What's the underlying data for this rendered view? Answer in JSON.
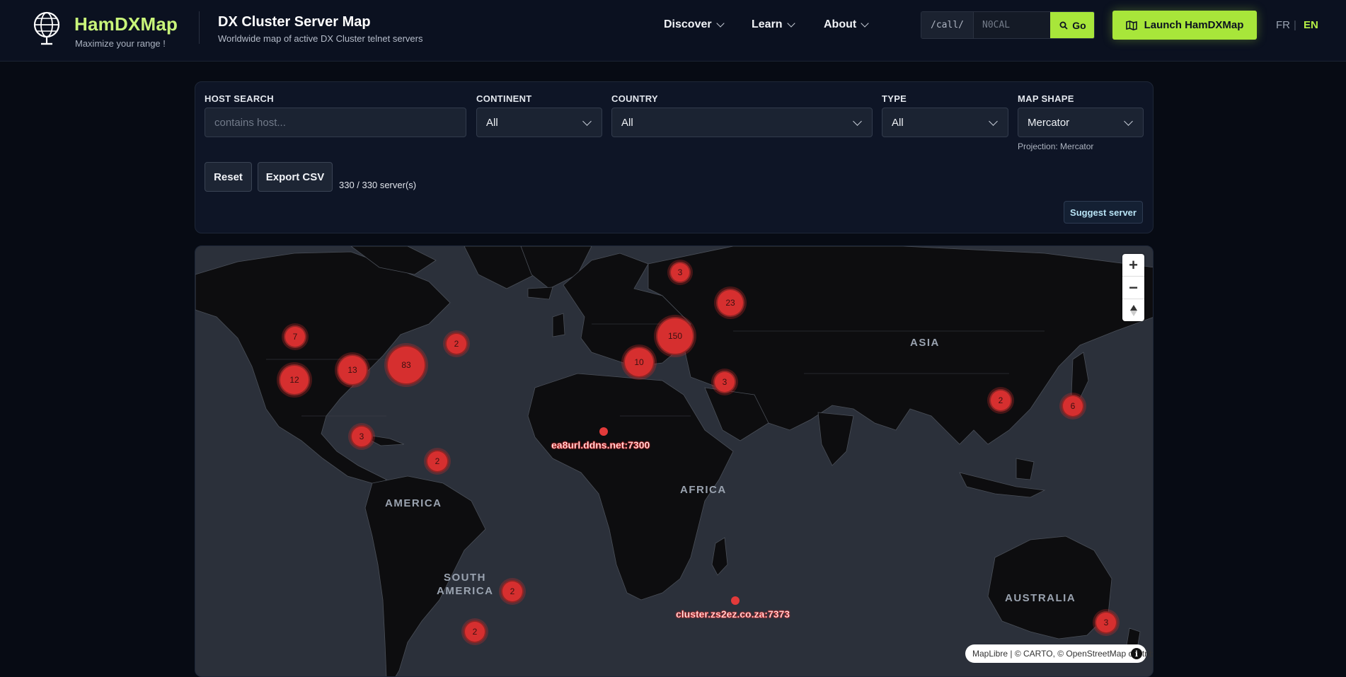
{
  "header": {
    "brand": "HamDXMap",
    "tagline": "Maximize your range !",
    "title": "DX Cluster Server Map",
    "subtitle": "Worldwide map of active DX Cluster telnet servers",
    "nav": [
      "Discover",
      "Learn",
      "About"
    ],
    "call_prefix": "/call/",
    "call_placeholder": "N0CAL",
    "go_label": "Go",
    "launch_label": "Launch HamDXMap",
    "lang_fr": "FR",
    "lang_sep": "|",
    "lang_en": "EN"
  },
  "filters": {
    "host_label": "HOST SEARCH",
    "host_placeholder": "contains host...",
    "continent_label": "CONTINENT",
    "continent_value": "All",
    "country_label": "COUNTRY",
    "country_value": "All",
    "type_label": "TYPE",
    "type_value": "All",
    "shape_label": "MAP SHAPE",
    "shape_value": "Mercator",
    "projection_note": "Projection: Mercator",
    "reset_label": "Reset",
    "export_label": "Export CSV",
    "count_text": "330 / 330 server(s)",
    "suggest_label": "Suggest server"
  },
  "map": {
    "labels": [
      "ASIA",
      "AMERICA",
      "AFRICA",
      "SOUTH",
      "AMERICA",
      "AUSTRALIA"
    ],
    "clusters": [
      "3",
      "23",
      "150",
      "7",
      "2",
      "13",
      "83",
      "12",
      "10",
      "3",
      "2",
      "6",
      "3",
      "2",
      "2",
      "2",
      "3"
    ],
    "pins": [
      "ea8url.ddns.net:7300",
      "cluster.zs2ez.co.za:7373"
    ],
    "attribution": {
      "maplibre": "MapLibre",
      "sep1": " | © ",
      "carto": "CARTO",
      "sep2": ", © ",
      "osm": "OpenStreetMap",
      "contrib": " contributors"
    },
    "zoom_in": "+",
    "zoom_out": "−"
  },
  "colors": {
    "accent": "#a8e63a",
    "brand": "#c9f57a",
    "cluster": "#d62f2f"
  }
}
